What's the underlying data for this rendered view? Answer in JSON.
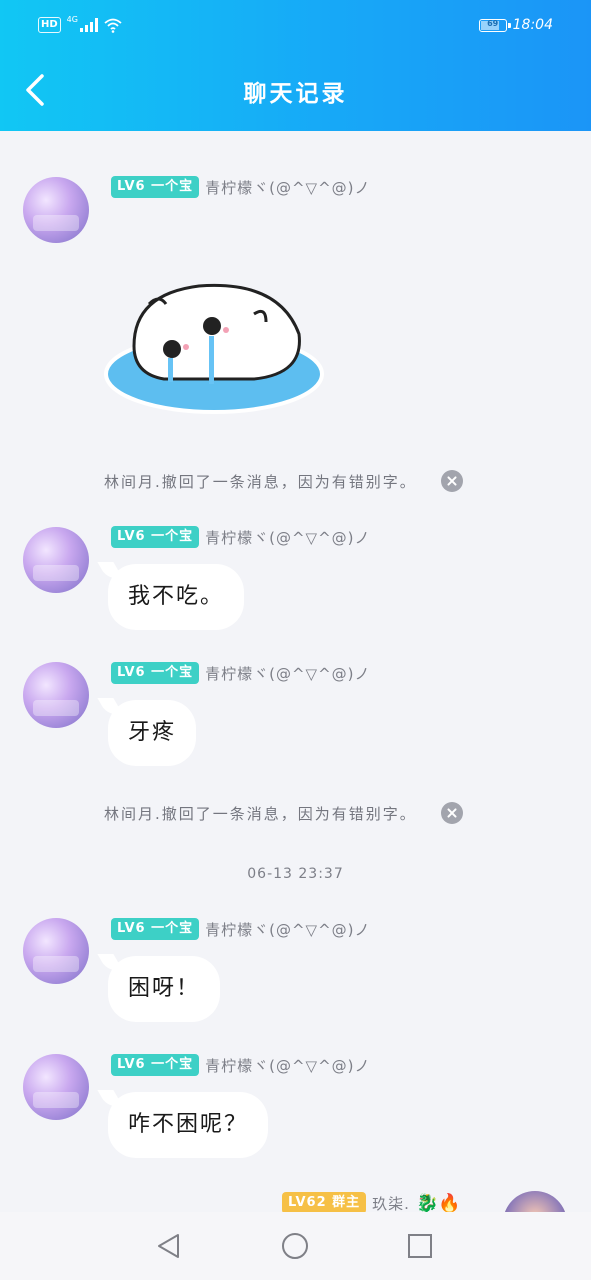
{
  "status_bar": {
    "hd": "HD",
    "network": "4G",
    "battery": "69",
    "battery_level": 0.69,
    "time": "18:04"
  },
  "header": {
    "title": "聊天记录"
  },
  "colors": {
    "header_start": "#11c7f4",
    "header_end": "#1b95f7",
    "badge_teal": "#3dd0c6",
    "badge_gold": "#f6c046"
  },
  "messages": {
    "m1": {
      "badge": "LV6 一个宝",
      "name": "青柠檬ヾ(@^▽^@)ノ",
      "type": "sticker"
    },
    "recall1": {
      "text": "林间月.撤回了一条消息，因为有错别字。"
    },
    "m2": {
      "badge": "LV6 一个宝",
      "name": "青柠檬ヾ(@^▽^@)ノ",
      "text": "我不吃。"
    },
    "m3": {
      "badge": "LV6 一个宝",
      "name": "青柠檬ヾ(@^▽^@)ノ",
      "text": "牙疼"
    },
    "recall2": {
      "text": "林间月.撤回了一条消息，因为有错别字。"
    },
    "timestamp": "06-13 23:37",
    "m4": {
      "badge": "LV6 一个宝",
      "name": "青柠檬ヾ(@^▽^@)ノ",
      "text": "困呀！"
    },
    "m5": {
      "badge": "LV6 一个宝",
      "name": "青柠檬ヾ(@^▽^@)ノ",
      "text": "咋不困呢？"
    },
    "m6": {
      "badge": "LV62 群主",
      "name": "玖柒.",
      "emojis": "🐉🔥"
    }
  },
  "icons": {
    "back": "chevron-left-icon",
    "close": "close-circle-icon",
    "nav_back": "triangle-back-icon",
    "nav_home": "circle-home-icon",
    "nav_recent": "square-recent-icon"
  }
}
